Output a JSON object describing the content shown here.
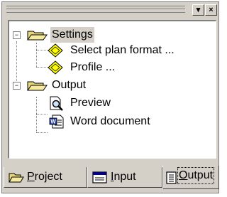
{
  "tree": {
    "nodes": [
      {
        "label": "Settings",
        "icon": "folder-open-icon",
        "expander": "−",
        "selected": true
      },
      {
        "label": "Select plan format ...",
        "icon": "diamond-icon"
      },
      {
        "label": "Profile ...",
        "icon": "diamond-icon"
      },
      {
        "label": "Output",
        "icon": "folder-open-icon",
        "expander": "−"
      },
      {
        "label": "Preview",
        "icon": "print-preview-icon"
      },
      {
        "label": "Word document",
        "icon": "word-document-icon"
      }
    ]
  },
  "tabs": [
    {
      "label": "Project",
      "underline_char": "P",
      "rest": "roject",
      "icon": "folder-open-icon"
    },
    {
      "label": "Input",
      "underline_char": "I",
      "rest": "nput",
      "icon": "input-form-icon"
    },
    {
      "label": "Output",
      "underline_char": "O",
      "rest": "utput",
      "icon": "document-list-icon",
      "active": true
    }
  ],
  "titlebar": {
    "menu_glyph": "▾",
    "close_glyph": "×"
  }
}
